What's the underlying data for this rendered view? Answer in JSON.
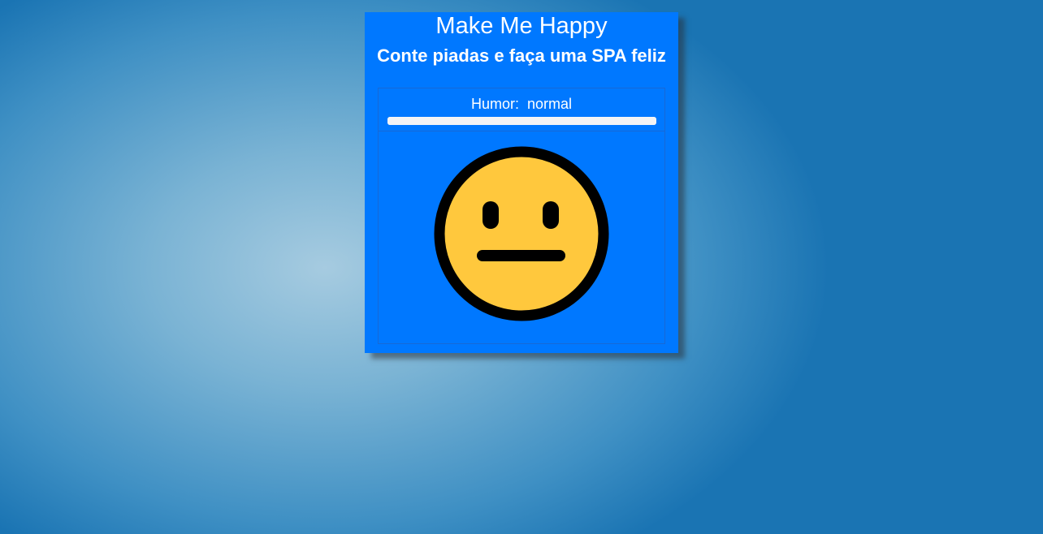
{
  "app": {
    "title": "Make Me Happy",
    "subtitle": "Conte piadas e faça uma SPA feliz"
  },
  "mood": {
    "label": "Humor:",
    "value": "normal",
    "level": 1.0
  },
  "face": {
    "expression": "neutral",
    "icon": "neutral-face-icon",
    "fill_color": "#ffc83d",
    "outline_color": "#000000"
  },
  "colors": {
    "card_background": "#0078ff",
    "page_background": "#4a95c6"
  }
}
